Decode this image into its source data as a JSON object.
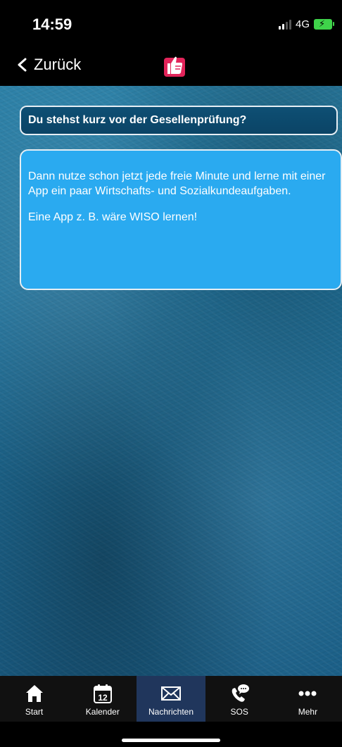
{
  "status_bar": {
    "time": "14:59",
    "network": "4G"
  },
  "nav": {
    "back_label": "Zurück"
  },
  "message": {
    "question": "Du stehst kurz vor der Gesellenprüfung?",
    "paragraphs": [
      "Dann nutze schon jetzt jede freie Minute und lerne mit einer App ein paar Wirtschafts- und Sozialkundeaufgaben.",
      "Eine App z. B. wäre WISO lernen!"
    ]
  },
  "tabs": [
    {
      "label": "Start",
      "icon": "home-icon",
      "active": false
    },
    {
      "label": "Kalender",
      "icon": "calendar-icon",
      "calendar_day": "12",
      "active": false
    },
    {
      "label": "Nachrichten",
      "icon": "mail-icon",
      "active": true
    },
    {
      "label": "SOS",
      "icon": "phone-chat-icon",
      "active": false
    },
    {
      "label": "Mehr",
      "icon": "more-icon",
      "active": false
    }
  ],
  "colors": {
    "answer_bubble": "#2aaaf0",
    "question_bubble": "#0e4f74",
    "active_tab": "#20365c",
    "logo": "#e2245a"
  }
}
